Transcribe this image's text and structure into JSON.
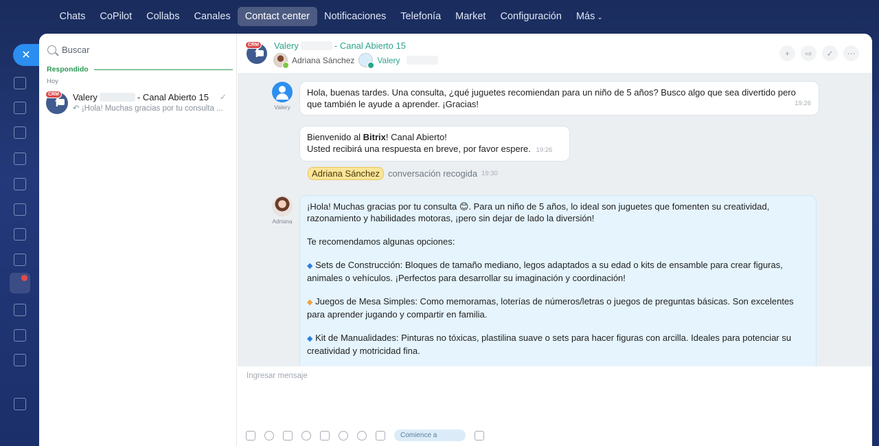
{
  "nav": {
    "items": [
      "Chats",
      "CoPilot",
      "Collabs",
      "Canales",
      "Contact center",
      "Notificaciones",
      "Telefonía",
      "Market",
      "Configuración",
      "Más"
    ],
    "active": "Contact center"
  },
  "sidebar": {
    "search_placeholder": "Buscar",
    "section_label": "Respondido",
    "day_label": "Hoy",
    "conversations": [
      {
        "crm_tag": "CRM",
        "name": "Valery",
        "channel": "- Canal Abierto 15",
        "preview": "¡Hola! Muchas gracias por tu consulta ..."
      }
    ]
  },
  "chat": {
    "crm_tag": "CRM",
    "title_name": "Valery",
    "title_channel": "- Canal Abierto 15",
    "participants": [
      "Adriana Sánchez",
      "Valery"
    ],
    "messages": {
      "m1": {
        "author": "Valery",
        "text": "Hola, buenas tardes. Una consulta, ¿qué juguetes recomiendan para un niño de 5 años? Busco algo que sea divertido pero que también le ayude a aprender. ¡Gracias!",
        "time": "19:26"
      },
      "m2": {
        "line1_pre": "Bienvenido al ",
        "line1_bold": "Bitrix",
        "line1_post": "! Canal Abierto!",
        "line2": "Usted recibirá una respuesta en breve, por favor espere.",
        "time": "19:26"
      },
      "system": {
        "tag": "Adriana Sánchez",
        "text": "conversación recogida",
        "time": "19:30"
      },
      "m3": {
        "author": "Adriana",
        "p1": "¡Hola! Muchas gracias por tu consulta 😊. Para un niño de 5 años, lo ideal son juguetes que fomenten su creatividad, razonamiento y habilidades motoras, ¡pero sin dejar de lado la diversión!",
        "p2": "Te recomendamos algunas opciones:",
        "p3": "Sets de Construcción: Bloques de tamaño mediano, legos adaptados a su edad o kits de ensamble para crear figuras, animales o vehículos. ¡Perfectos para desarrollar su imaginación y coordinación!",
        "p4": "Juegos de Mesa Simples: Como memoramas, loterías de números/letras o juegos de preguntas básicas. Son excelentes para aprender jugando y compartir en familia.",
        "p5": "Kit de Manualidades: Pinturas no tóxicas, plastilina suave o sets para hacer figuras con arcilla. Ideales para potenciar su creatividad y motricidad fina."
      }
    },
    "composer": {
      "placeholder": "Ingresar mensaje",
      "start_label": "Comience a"
    }
  }
}
